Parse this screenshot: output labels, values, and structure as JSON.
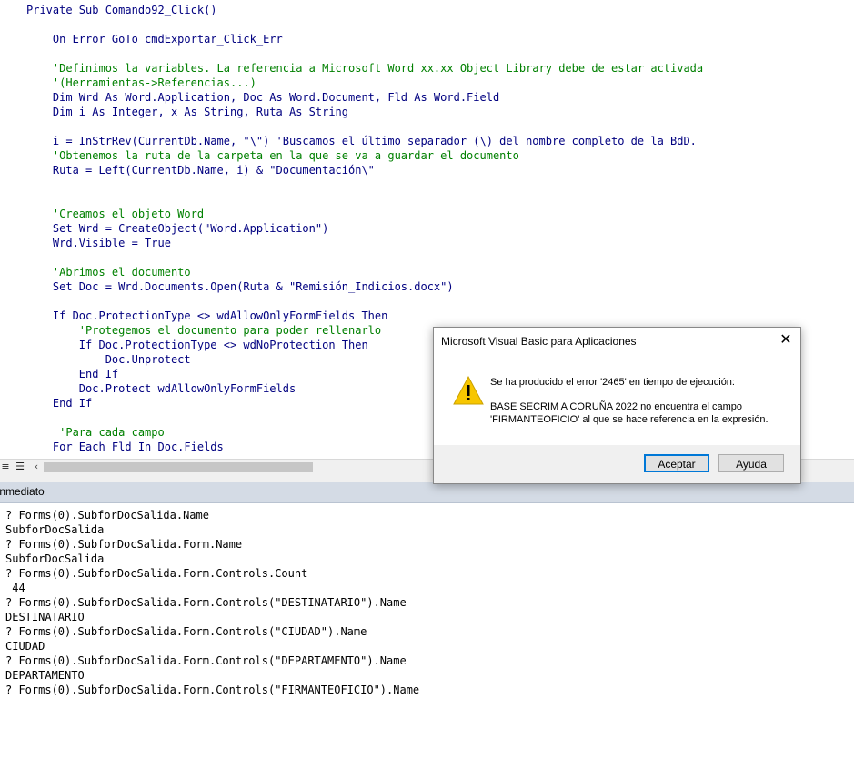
{
  "editor": {
    "lines": [
      {
        "text": "Private Sub Comando92_Click()",
        "type": "code"
      },
      {
        "text": "",
        "type": "code"
      },
      {
        "text": "    On Error GoTo cmdExportar_Click_Err",
        "type": "code"
      },
      {
        "text": "",
        "type": "code"
      },
      {
        "text": "    'Definimos la variables. La referencia a Microsoft Word xx.xx Object Library debe de estar activada",
        "type": "comment"
      },
      {
        "text": "    '(Herramientas->Referencias...)",
        "type": "comment"
      },
      {
        "text": "    Dim Wrd As Word.Application, Doc As Word.Document, Fld As Word.Field",
        "type": "code"
      },
      {
        "text": "    Dim i As Integer, x As String, Ruta As String",
        "type": "code"
      },
      {
        "text": "",
        "type": "code"
      },
      {
        "text": "    i = InStrRev(CurrentDb.Name, \"\\\") 'Buscamos el último separador (\\) del nombre completo de la BdD.",
        "type": "code"
      },
      {
        "text": "    'Obtenemos la ruta de la carpeta en la que se va a guardar el documento",
        "type": "comment"
      },
      {
        "text": "    Ruta = Left(CurrentDb.Name, i) & \"Documentación\\\"",
        "type": "code"
      },
      {
        "text": "",
        "type": "code"
      },
      {
        "text": "",
        "type": "code"
      },
      {
        "text": "    'Creamos el objeto Word",
        "type": "comment"
      },
      {
        "text": "    Set Wrd = CreateObject(\"Word.Application\")",
        "type": "code"
      },
      {
        "text": "    Wrd.Visible = True",
        "type": "code"
      },
      {
        "text": "",
        "type": "code"
      },
      {
        "text": "    'Abrimos el documento",
        "type": "comment"
      },
      {
        "text": "    Set Doc = Wrd.Documents.Open(Ruta & \"Remisión_Indicios.docx\")",
        "type": "code"
      },
      {
        "text": "",
        "type": "code"
      },
      {
        "text": "    If Doc.ProtectionType <> wdAllowOnlyFormFields Then",
        "type": "code"
      },
      {
        "text": "        'Protegemos el documento para poder rellenarlo",
        "type": "comment"
      },
      {
        "text": "        If Doc.ProtectionType <> wdNoProtection Then",
        "type": "code"
      },
      {
        "text": "            Doc.Unprotect",
        "type": "code"
      },
      {
        "text": "        End If",
        "type": "code"
      },
      {
        "text": "        Doc.Protect wdAllowOnlyFormFields",
        "type": "code"
      },
      {
        "text": "    End If",
        "type": "code"
      },
      {
        "text": "",
        "type": "code"
      },
      {
        "text": "     'Para cada campo",
        "type": "comment"
      },
      {
        "text": "    For Each Fld In Doc.Fields",
        "type": "code"
      }
    ]
  },
  "immediate": {
    "title": "Inmediato",
    "lines": [
      "? Forms(0).SubforDocSalida.Name",
      "SubforDocSalida",
      "? Forms(0).SubforDocSalida.Form.Name",
      "SubforDocSalida",
      "? Forms(0).SubforDocSalida.Form.Controls.Count",
      " 44",
      "? Forms(0).SubforDocSalida.Form.Controls(\"DESTINATARIO\").Name",
      "DESTINATARIO",
      "? Forms(0).SubforDocSalida.Form.Controls(\"CIUDAD\").Name",
      "CIUDAD",
      "? Forms(0).SubforDocSalida.Form.Controls(\"DEPARTAMENTO\").Name",
      "DEPARTAMENTO",
      "? Forms(0).SubforDocSalida.Form.Controls(\"FIRMANTEOFICIO\").Name"
    ]
  },
  "dialog": {
    "title": "Microsoft Visual Basic para Aplicaciones",
    "close": "✕",
    "message1": "Se ha producido el error '2465' en tiempo de ejecución:",
    "message2": "BASE SECRIM A CORUÑA 2022 no encuentra el campo 'FIRMANTEOFICIO' al que se hace referencia en la expresión.",
    "ok_label": "Aceptar",
    "help_label": "Ayuda",
    "icon": "warning-icon"
  },
  "scrollbar": {
    "procedure_view_icon": "≡",
    "module_view_icon": "☰",
    "left_arrow": "‹"
  },
  "colors": {
    "keyword": "#000080",
    "comment": "#008000",
    "immediate_titlebar": "#d4dbe5"
  }
}
